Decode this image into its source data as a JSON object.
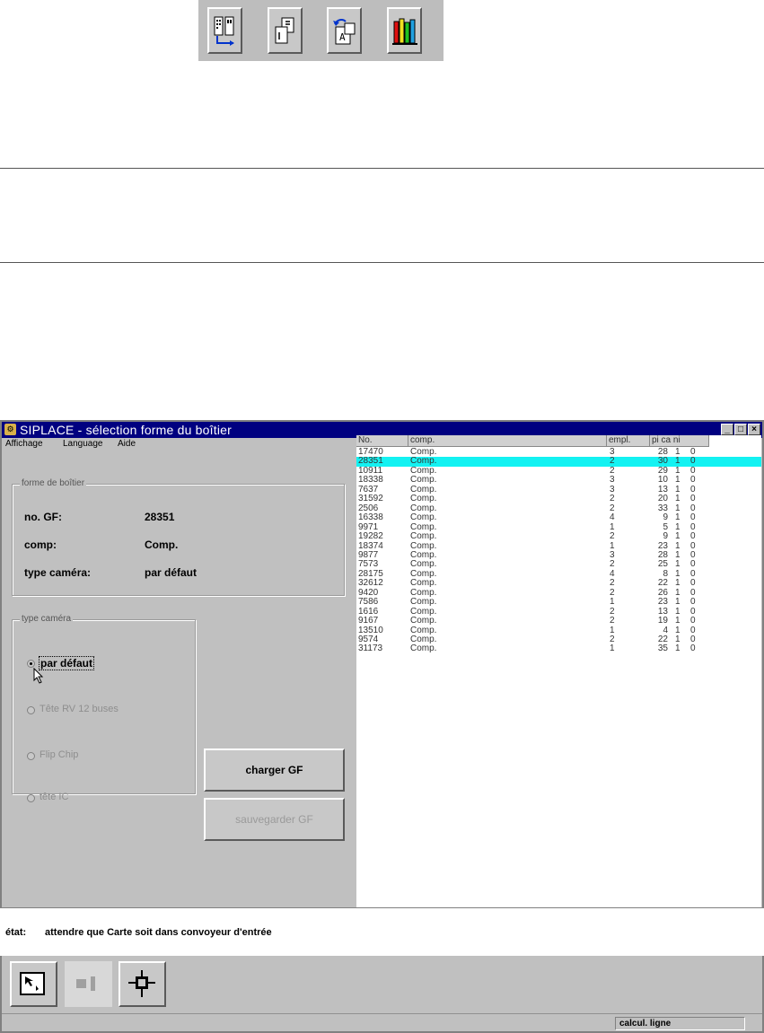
{
  "toolbar": {
    "buttons": [
      {
        "icon": "board-layout-icon"
      },
      {
        "icon": "component-page-icon"
      },
      {
        "icon": "refresh-document-icon"
      },
      {
        "icon": "library-books-icon"
      }
    ]
  },
  "window": {
    "title": "SIPLACE - sélection forme du boîtier",
    "controls": [
      "_",
      "□",
      "×"
    ],
    "menu": [
      {
        "label": "Affichage"
      },
      {
        "label": "Language"
      },
      {
        "label": "Aide"
      }
    ]
  },
  "form_group": {
    "label": "forme de boîtier",
    "no_gf_label": "no. GF:",
    "no_gf_value": "28351",
    "comp_label": "comp:",
    "comp_value": "Comp.",
    "camera_label": "type caméra:",
    "camera_value": "par défaut"
  },
  "camera_group": {
    "label": "type caméra",
    "options": [
      {
        "label": "par défaut",
        "checked": true,
        "enabled": true
      },
      {
        "label": "Tête RV 12 buses",
        "checked": false,
        "enabled": false
      },
      {
        "label": "Flip Chip",
        "checked": false,
        "enabled": false
      },
      {
        "label": "tête IC",
        "checked": false,
        "enabled": false
      }
    ]
  },
  "buttons": {
    "load": "charger GF",
    "save": "sauvegarder GF"
  },
  "list": {
    "headers": [
      "No.",
      "comp.",
      "empl.",
      "pi ca ni"
    ],
    "selected_index": 1,
    "rows": [
      {
        "no": "17470",
        "comp": "Comp.",
        "empl": "3",
        "pi": "28",
        "ca": "1",
        "ni": "0"
      },
      {
        "no": "28351",
        "comp": "Comp.",
        "empl": "2",
        "pi": "30",
        "ca": "1",
        "ni": "0"
      },
      {
        "no": "10911",
        "comp": "Comp.",
        "empl": "2",
        "pi": "29",
        "ca": "1",
        "ni": "0"
      },
      {
        "no": "18338",
        "comp": "Comp.",
        "empl": "3",
        "pi": "10",
        "ca": "1",
        "ni": "0"
      },
      {
        "no": "7637",
        "comp": "Comp.",
        "empl": "3",
        "pi": "13",
        "ca": "1",
        "ni": "0"
      },
      {
        "no": "31592",
        "comp": "Comp.",
        "empl": "2",
        "pi": "20",
        "ca": "1",
        "ni": "0"
      },
      {
        "no": "2506",
        "comp": "Comp.",
        "empl": "2",
        "pi": "33",
        "ca": "1",
        "ni": "0"
      },
      {
        "no": "16338",
        "comp": "Comp.",
        "empl": "4",
        "pi": "9",
        "ca": "1",
        "ni": "0"
      },
      {
        "no": "9971",
        "comp": "Comp.",
        "empl": "1",
        "pi": "5",
        "ca": "1",
        "ni": "0"
      },
      {
        "no": "19282",
        "comp": "Comp.",
        "empl": "2",
        "pi": "9",
        "ca": "1",
        "ni": "0"
      },
      {
        "no": "18374",
        "comp": "Comp.",
        "empl": "1",
        "pi": "23",
        "ca": "1",
        "ni": "0"
      },
      {
        "no": "9877",
        "comp": "Comp.",
        "empl": "3",
        "pi": "28",
        "ca": "1",
        "ni": "0"
      },
      {
        "no": "7573",
        "comp": "Comp.",
        "empl": "2",
        "pi": "25",
        "ca": "1",
        "ni": "0"
      },
      {
        "no": "28175",
        "comp": "Comp.",
        "empl": "4",
        "pi": "8",
        "ca": "1",
        "ni": "0"
      },
      {
        "no": "32612",
        "comp": "Comp.",
        "empl": "2",
        "pi": "22",
        "ca": "1",
        "ni": "0"
      },
      {
        "no": "9420",
        "comp": "Comp.",
        "empl": "2",
        "pi": "26",
        "ca": "1",
        "ni": "0"
      },
      {
        "no": "7586",
        "comp": "Comp.",
        "empl": "1",
        "pi": "23",
        "ca": "1",
        "ni": "0"
      },
      {
        "no": "1616",
        "comp": "Comp.",
        "empl": "2",
        "pi": "13",
        "ca": "1",
        "ni": "0"
      },
      {
        "no": "9167",
        "comp": "Comp.",
        "empl": "2",
        "pi": "19",
        "ca": "1",
        "ni": "0"
      },
      {
        "no": "13510",
        "comp": "Comp.",
        "empl": "1",
        "pi": "4",
        "ca": "1",
        "ni": "0"
      },
      {
        "no": "9574",
        "comp": "Comp.",
        "empl": "2",
        "pi": "22",
        "ca": "1",
        "ni": "0"
      },
      {
        "no": "31173",
        "comp": "Comp.",
        "empl": "1",
        "pi": "35",
        "ca": "1",
        "ni": "0"
      }
    ]
  },
  "status": {
    "label": "état:",
    "text": "attendre que Carte soit dans convoyeur d'entrée"
  },
  "bottom_buttons": [
    {
      "icon": "select-pointer-icon",
      "state": "raised"
    },
    {
      "icon": "component-block-icon",
      "state": "flat"
    },
    {
      "icon": "crosshair-chip-icon",
      "state": "raised"
    }
  ],
  "statusbar": {
    "field": "calcul. ligne"
  },
  "colors": {
    "titlebar": "#000080",
    "selection": "#13f2f2",
    "face": "#c0c0c0"
  }
}
